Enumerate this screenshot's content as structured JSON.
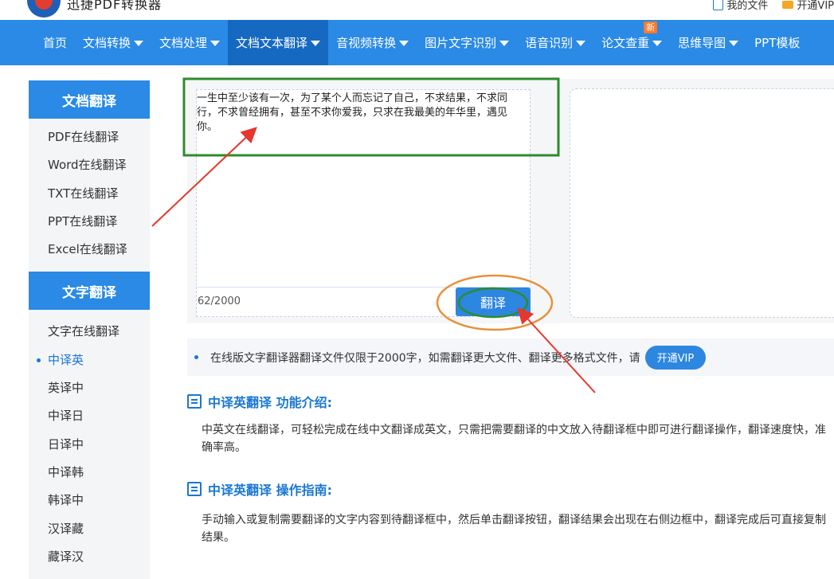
{
  "header": {
    "brand": "迅捷PDF转换器",
    "my_files": "我的文件",
    "open_vip": "开通VIP"
  },
  "nav": {
    "items": [
      {
        "label": "首页",
        "dropdown": false
      },
      {
        "label": "文档转换",
        "dropdown": true
      },
      {
        "label": "文档处理",
        "dropdown": true
      },
      {
        "label": "文档文本翻译",
        "dropdown": true,
        "active": true
      },
      {
        "label": "音视频转换",
        "dropdown": true
      },
      {
        "label": "图片文字识别",
        "dropdown": true
      },
      {
        "label": "语音识别",
        "dropdown": true
      },
      {
        "label": "论文查重",
        "dropdown": true,
        "badge": "新"
      },
      {
        "label": "思维导图",
        "dropdown": true
      },
      {
        "label": "PPT模板",
        "dropdown": false
      }
    ]
  },
  "sidebar": {
    "doc_header": "文档翻译",
    "doc_items": [
      "PDF在线翻译",
      "Word在线翻译",
      "TXT在线翻译",
      "PPT在线翻译",
      "Excel在线翻译"
    ],
    "text_header": "文字翻译",
    "text_items": [
      "文字在线翻译",
      "中译英",
      "英译中",
      "中译日",
      "日译中",
      "中译韩",
      "韩译中",
      "汉译藏",
      "藏译汉"
    ],
    "active_item": "中译英"
  },
  "editor": {
    "text": "一生中至少该有一次，为了某个人而忘记了自己，不求结果，不求同行，不求曾经拥有，甚至不求你爱我，只求在我最美的年华里，遇见你。",
    "char_count": "62/2000",
    "translate_button": "翻译"
  },
  "notice": {
    "text": "在线版文字翻译器翻译文件仅限于2000字，如需翻译更大文件、翻译更多格式文件，请",
    "vip_button": "开通VIP"
  },
  "sections": {
    "intro_title": "中译英翻译 功能介绍:",
    "intro_body": "中英文在线翻译，可轻松完成在线中文翻译成英文，只需把需要翻译的中文放入待翻译框中即可进行翻译操作，翻译速度快，准确率高。",
    "guide_title": "中译英翻译 操作指南:",
    "guide_body": "手动输入或复制需要翻译的文字内容到待翻译框中，然后单击翻译按钮，翻译结果会出现在右侧边框中，翻译完成后可直接复制结果。"
  },
  "colors": {
    "primary": "#2a8ae5",
    "nav_active": "#1669c1",
    "annotation_red": "#e5372c",
    "annotation_green": "#2e8b2e",
    "annotation_orange": "#e8913a"
  }
}
